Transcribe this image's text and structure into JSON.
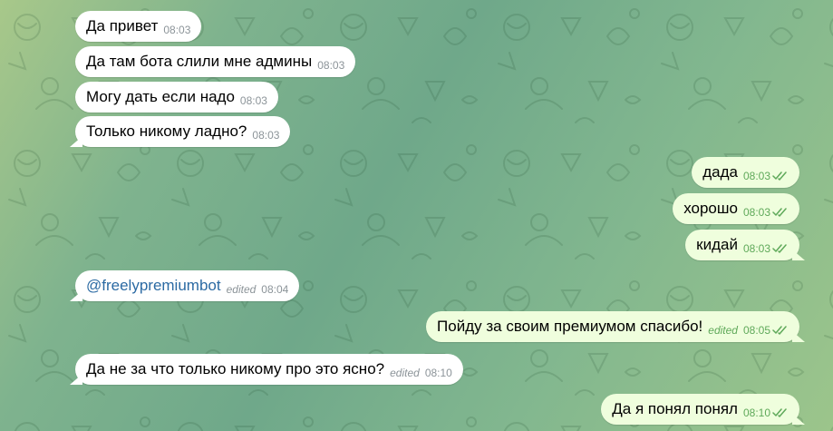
{
  "messages": [
    {
      "text": "Да привет",
      "time": "08:03"
    },
    {
      "text": "Да там бота слили мне админы",
      "time": "08:03"
    },
    {
      "text": "Могу дать если надо",
      "time": "08:03"
    },
    {
      "text": "Только никому ладно?",
      "time": "08:03"
    },
    {
      "text": "дада",
      "time": "08:03"
    },
    {
      "text": "хорошо",
      "time": "08:03"
    },
    {
      "text": "кидай",
      "time": "08:03"
    },
    {
      "text": "@freelypremiumbot",
      "edited": "edited",
      "time": "08:04"
    },
    {
      "text": "Пойду за своим премиумом спасибо!",
      "edited": "edited",
      "time": "08:05"
    },
    {
      "text": "Да не за что только никому про это ясно?",
      "edited": "edited",
      "time": "08:10"
    },
    {
      "text": "Да я понял понял",
      "time": "08:10"
    }
  ],
  "colors": {
    "incoming_bubble": "#ffffff",
    "outgoing_bubble": "#effedd",
    "link": "#2b6aa3",
    "read_check": "#5fa95a"
  },
  "icons": {
    "read_receipt": "double-check-icon"
  }
}
